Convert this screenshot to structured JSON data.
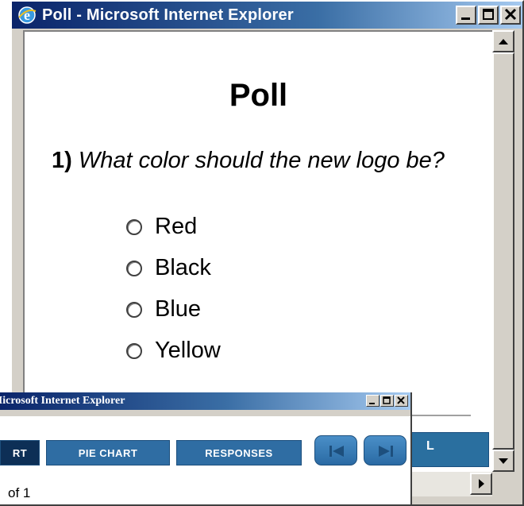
{
  "main_window": {
    "title": "Poll - Microsoft Internet Explorer",
    "page_heading": "Poll",
    "question": {
      "number": "1)",
      "text": "What color should the new logo be?"
    },
    "options": [
      "Red",
      "Black",
      "Blue",
      "Yellow"
    ],
    "bottom_bar_fragment": "L"
  },
  "second_window": {
    "title": "Microsoft Internet Explorer",
    "tabs": {
      "active_fragment": "RT",
      "pie_chart": "PIE CHART",
      "responses": "RESPONSES"
    },
    "page_indicator": "of 1"
  },
  "colors": {
    "titlebar_start": "#0a246a",
    "titlebar_end": "#a6caf0",
    "tab_blue": "#2f6da3",
    "tab_active": "#0d2f56",
    "window_face": "#d4d0c8"
  },
  "icons": [
    "ie-logo-icon",
    "minimize-icon",
    "maximize-icon",
    "close-icon",
    "scroll-up-icon",
    "scroll-down-icon",
    "scroll-right-icon",
    "prev-icon",
    "next-icon"
  ]
}
